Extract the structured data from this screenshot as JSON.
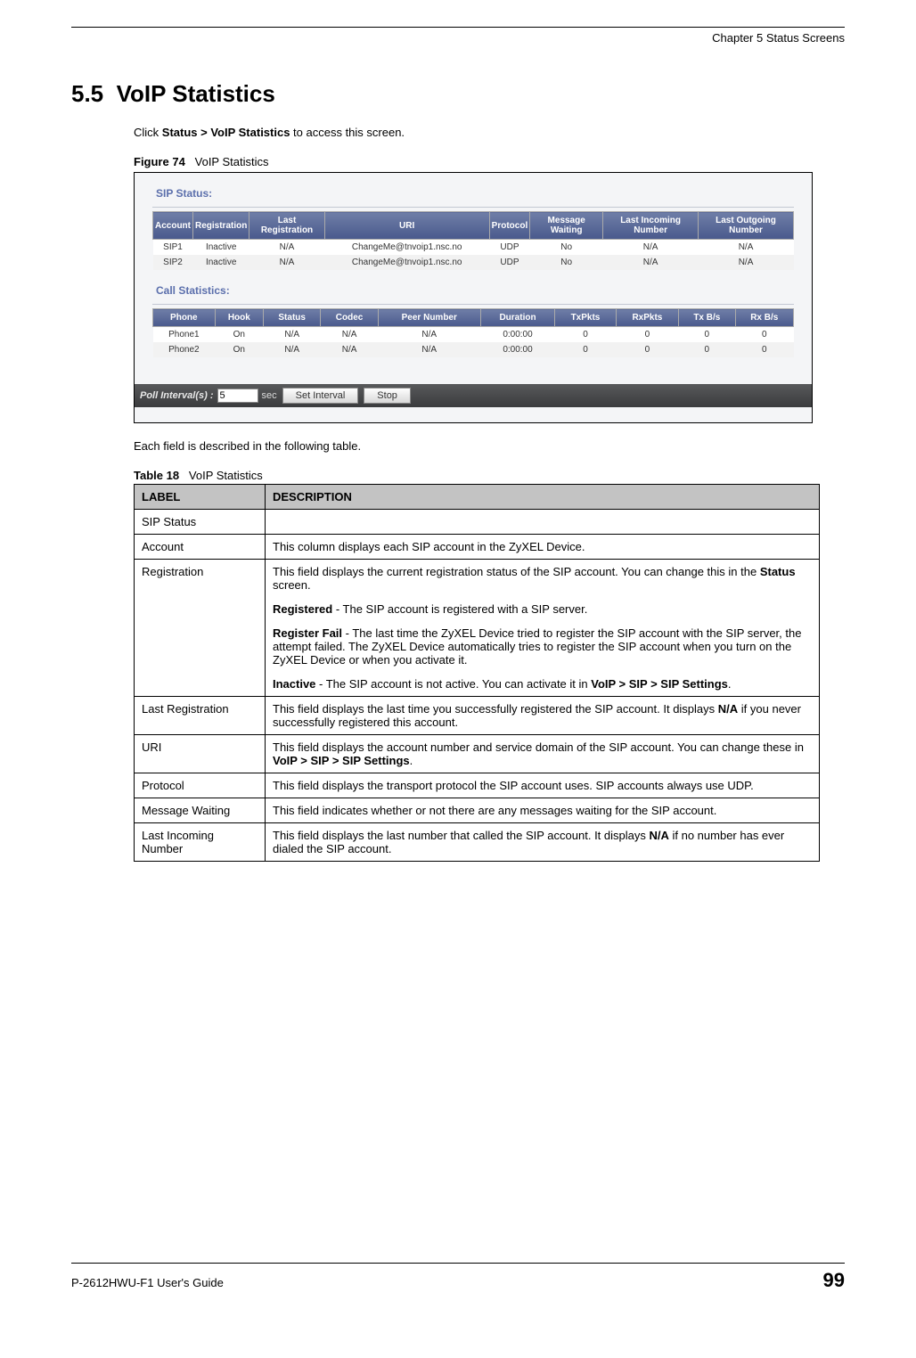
{
  "header": {
    "chapter": "Chapter 5 Status Screens"
  },
  "section": {
    "number": "5.5",
    "title": "VoIP Statistics"
  },
  "intro": {
    "prefix": "Click ",
    "bold": "Status > VoIP Statistics",
    "suffix": " to access this screen."
  },
  "figure": {
    "label": "Figure 74",
    "caption": "VoIP Statistics"
  },
  "ui": {
    "sip_title": "SIP Status:",
    "sip_headers": [
      "Account",
      "Registration",
      "Last Registration",
      "URI",
      "Protocol",
      "Message Waiting",
      "Last Incoming Number",
      "Last Outgoing Number"
    ],
    "sip_rows": [
      {
        "account": "SIP1",
        "reg": "Inactive",
        "last": "N/A",
        "uri": "ChangeMe@tnvoip1.nsc.no",
        "proto": "UDP",
        "msg": "No",
        "in": "N/A",
        "out": "N/A"
      },
      {
        "account": "SIP2",
        "reg": "Inactive",
        "last": "N/A",
        "uri": "ChangeMe@tnvoip1.nsc.no",
        "proto": "UDP",
        "msg": "No",
        "in": "N/A",
        "out": "N/A"
      }
    ],
    "call_title": "Call Statistics:",
    "call_headers": [
      "Phone",
      "Hook",
      "Status",
      "Codec",
      "Peer Number",
      "Duration",
      "TxPkts",
      "RxPkts",
      "Tx B/s",
      "Rx B/s"
    ],
    "call_rows": [
      {
        "phone": "Phone1",
        "hook": "On",
        "status": "N/A",
        "codec": "N/A",
        "peer": "N/A",
        "dur": "0:00:00",
        "tx": "0",
        "rx": "0",
        "txb": "0",
        "rxb": "0"
      },
      {
        "phone": "Phone2",
        "hook": "On",
        "status": "N/A",
        "codec": "N/A",
        "peer": "N/A",
        "dur": "0:00:00",
        "tx": "0",
        "rx": "0",
        "txb": "0",
        "rxb": "0"
      }
    ],
    "poll_label": "Poll Interval(s) :",
    "poll_value": "5",
    "poll_sec": "sec",
    "btn_set": "Set Interval",
    "btn_stop": "Stop"
  },
  "after_figure": "Each field is described in the following table.",
  "table_caption": {
    "label": "Table 18",
    "caption": "VoIP Statistics"
  },
  "desc_headers": {
    "label": "LABEL",
    "description": "DESCRIPTION"
  },
  "desc_rows": {
    "r0": {
      "label": "SIP Status",
      "desc": ""
    },
    "r1": {
      "label": "Account",
      "desc": "This column displays each SIP account in the ZyXEL Device."
    },
    "r2": {
      "label": "Registration",
      "p1a": "This field displays the current registration status of the SIP account. You can change this in the ",
      "p1b": "Status",
      "p1c": " screen.",
      "p2a": "Registered",
      "p2b": " - The SIP account is registered with a SIP server.",
      "p3a": "Register Fail",
      "p3b": " - The last time the ZyXEL Device tried to register the SIP account with the SIP server, the attempt failed. The ZyXEL Device automatically tries to register the SIP account when you turn on the ZyXEL Device or when you activate it.",
      "p4a": "Inactive",
      "p4b": " - The SIP account is not active. You can activate it in ",
      "p4c": "VoIP > SIP > SIP Settings",
      "p4d": "."
    },
    "r3": {
      "label": "Last Registration",
      "a": "This field displays the last time you successfully registered the SIP account. It displays ",
      "b": "N/A",
      "c": " if you never successfully registered this account."
    },
    "r4": {
      "label": "URI",
      "a": "This field displays the account number and service domain of the SIP account. You can change these in ",
      "b": "VoIP > SIP > SIP Settings",
      "c": "."
    },
    "r5": {
      "label": "Protocol",
      "desc": "This field displays the transport protocol the SIP account uses. SIP accounts always use UDP."
    },
    "r6": {
      "label": "Message Waiting",
      "desc": "This field indicates whether or not there are any messages waiting for the SIP account."
    },
    "r7": {
      "label": "Last Incoming Number",
      "a": "This field displays the last number that called the SIP account. It displays ",
      "b": "N/A",
      "c": " if no number has ever dialed the SIP account."
    }
  },
  "footer": {
    "guide": "P-2612HWU-F1 User's Guide",
    "page": "99"
  }
}
